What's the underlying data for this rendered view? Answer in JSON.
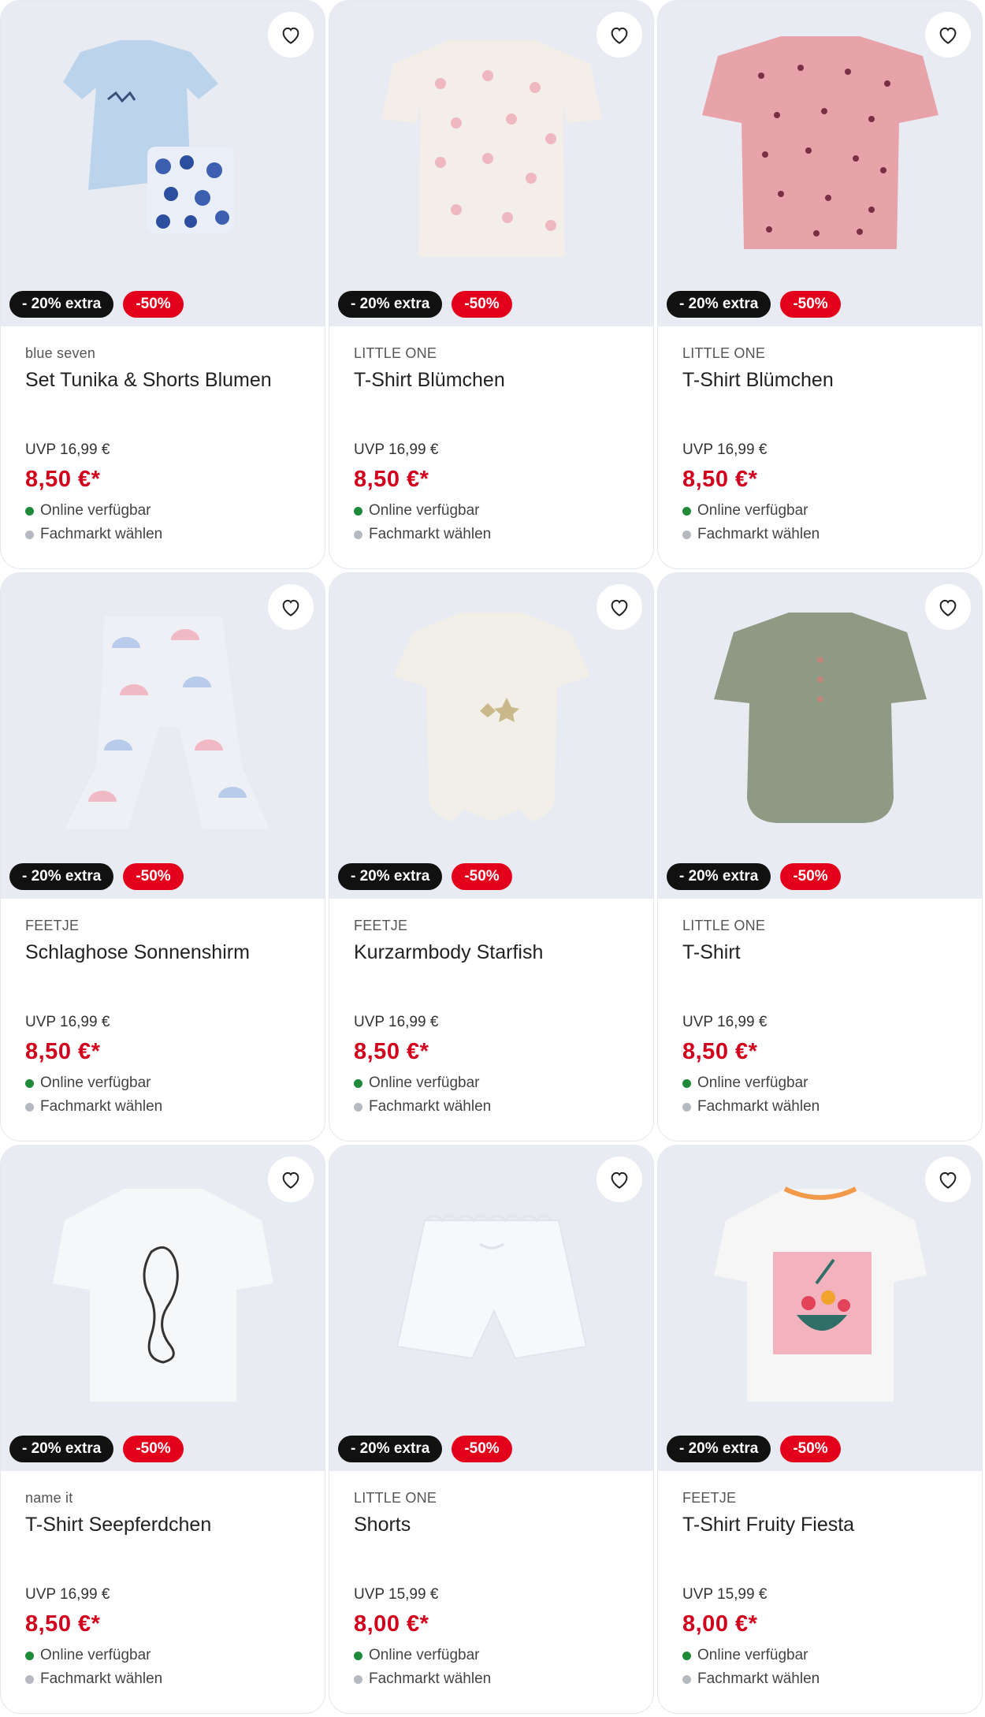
{
  "colors": {
    "price": "#d2001c",
    "sale_badge": "#e3001b",
    "extra_badge": "#111111",
    "available_dot": "#1e8a3a",
    "store_dot": "#b5b9c0",
    "image_background": "#e8ecf2"
  },
  "products": [
    {
      "brand": "blue seven",
      "title": "Set Tunika & Shorts Blumen",
      "badge_extra": "- 20% extra",
      "badge_sale": "-50%",
      "uvp": "UVP 16,99 €",
      "price": "8,50 €*",
      "online": "Online verfügbar",
      "store": "Fachmarkt wählen",
      "image": "tunic-shorts-set",
      "icon": "heart-icon"
    },
    {
      "brand": "LITTLE ONE",
      "title": "T-Shirt Blümchen",
      "badge_extra": "- 20% extra",
      "badge_sale": "-50%",
      "uvp": "UVP 16,99 €",
      "price": "8,50 €*",
      "online": "Online verfügbar",
      "store": "Fachmarkt wählen",
      "image": "tshirt-cream-flowers",
      "icon": "heart-icon"
    },
    {
      "brand": "LITTLE ONE",
      "title": "T-Shirt Blümchen",
      "badge_extra": "- 20% extra",
      "badge_sale": "-50%",
      "uvp": "UVP 16,99 €",
      "price": "8,50 €*",
      "online": "Online verfügbar",
      "store": "Fachmarkt wählen",
      "image": "tshirt-pink-flowers",
      "icon": "heart-icon"
    },
    {
      "brand": "FEETJE",
      "title": "Schlaghose Sonnenshirm",
      "badge_extra": "- 20% extra",
      "badge_sale": "-50%",
      "uvp": "UVP 16,99 €",
      "price": "8,50 €*",
      "online": "Online verfügbar",
      "store": "Fachmarkt wählen",
      "image": "flared-pants",
      "icon": "heart-icon"
    },
    {
      "brand": "FEETJE",
      "title": "Kurzarmbody Starfish",
      "badge_extra": "- 20% extra",
      "badge_sale": "-50%",
      "uvp": "UVP 16,99 €",
      "price": "8,50 €*",
      "online": "Online verfügbar",
      "store": "Fachmarkt wählen",
      "image": "body-starfish",
      "icon": "heart-icon"
    },
    {
      "brand": "LITTLE ONE",
      "title": "T-Shirt",
      "badge_extra": "- 20% extra",
      "badge_sale": "-50%",
      "uvp": "UVP 16,99 €",
      "price": "8,50 €*",
      "online": "Online verfügbar",
      "store": "Fachmarkt wählen",
      "image": "tshirt-green",
      "icon": "heart-icon"
    },
    {
      "brand": "name it",
      "title": "T-Shirt Seepferdchen",
      "badge_extra": "- 20% extra",
      "badge_sale": "-50%",
      "uvp": "UVP 16,99 €",
      "price": "8,50 €*",
      "online": "Online verfügbar",
      "store": "Fachmarkt wählen",
      "image": "tshirt-seahorse",
      "icon": "heart-icon"
    },
    {
      "brand": "LITTLE ONE",
      "title": "Shorts",
      "badge_extra": "- 20% extra",
      "badge_sale": "-50%",
      "uvp": "UVP 15,99 €",
      "price": "8,00 €*",
      "online": "Online verfügbar",
      "store": "Fachmarkt wählen",
      "image": "shorts-white",
      "icon": "heart-icon"
    },
    {
      "brand": "FEETJE",
      "title": "T-Shirt Fruity Fiesta",
      "badge_extra": "- 20% extra",
      "badge_sale": "-50%",
      "uvp": "UVP 15,99 €",
      "price": "8,00 €*",
      "online": "Online verfügbar",
      "store": "Fachmarkt wählen",
      "image": "tshirt-fruity",
      "icon": "heart-icon"
    }
  ]
}
